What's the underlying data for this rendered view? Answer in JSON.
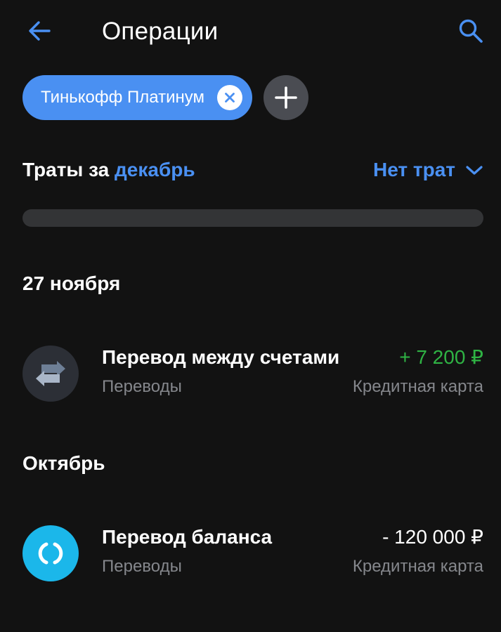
{
  "header": {
    "title": "Операции",
    "back_icon": "arrow-left-icon",
    "search_icon": "search-icon"
  },
  "filters": {
    "chip_label": "Тинькофф Платинум",
    "chip_close_icon": "close-icon",
    "add_icon": "plus-icon"
  },
  "spending": {
    "prefix": "Траты за",
    "month": "декабрь",
    "status": "Нет трат",
    "status_icon": "chevron-down-icon",
    "progress": 0
  },
  "groups": [
    {
      "title": "27 ноября",
      "transactions": [
        {
          "name": "Перевод между счетами",
          "category": "Переводы",
          "amount": "+ 7 200 ₽",
          "account": "Кредитная карта",
          "icon": "transfer-arrows-icon"
        }
      ]
    },
    {
      "title": "Октябрь",
      "transactions": [
        {
          "name": "Перевод баланса",
          "category": "Переводы",
          "amount": "- 120 000 ₽",
          "account": "Кредитная карта",
          "icon": "balance-transfer-icon"
        }
      ]
    }
  ],
  "colors": {
    "background": "#121212",
    "accent": "#4a90f2",
    "positive": "#2fb344",
    "secondary_text": "#85878c",
    "balance_icon_bg": "#1bb7ea"
  }
}
